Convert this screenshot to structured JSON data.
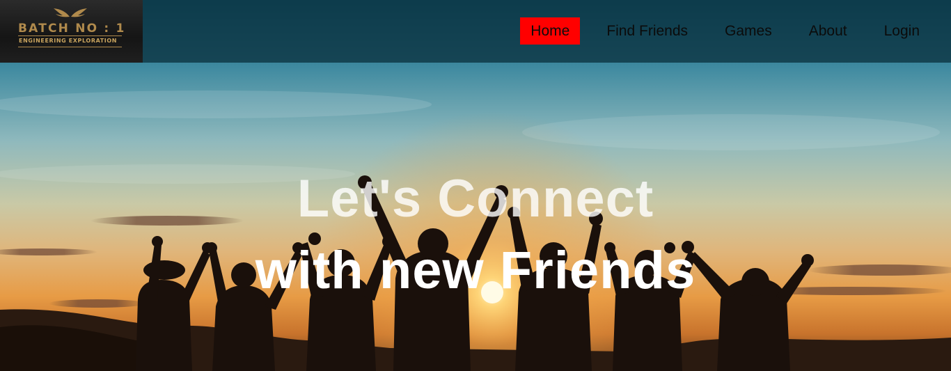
{
  "brand": {
    "logo_title": "BATCH NO : 1",
    "logo_subtitle": "ENGINEERING EXPLORATION",
    "logo_icon": "wings-icon",
    "logo_color": "#b08a4c"
  },
  "nav": {
    "items": [
      {
        "label": "Home",
        "active": true
      },
      {
        "label": "Find Friends",
        "active": false
      },
      {
        "label": "Games",
        "active": false
      },
      {
        "label": "About",
        "active": false
      },
      {
        "label": "Login",
        "active": false
      }
    ],
    "active_color": "#ff0000",
    "bar_color": "#0c3442"
  },
  "hero": {
    "headline_line1": "Let's Connect",
    "headline_line2": "with new Friends",
    "image": "silhouettes of friends raising hands at sunset"
  }
}
